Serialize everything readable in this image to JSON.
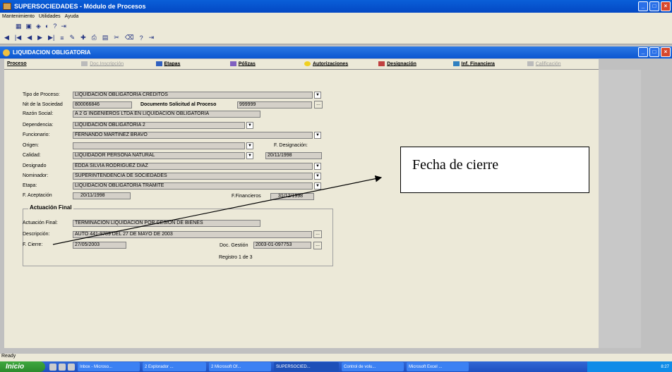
{
  "app": {
    "title": "SUPERSOCIEDADES - Módulo de Procesos",
    "menu": [
      "Mantenimiento",
      "Utilidades",
      "Ayuda"
    ]
  },
  "child": {
    "title": "LIQUIDACION OBLIGATORIA"
  },
  "tabs": [
    {
      "label": "Proceso",
      "enabled": true
    },
    {
      "label": "Doc.Inscripción",
      "enabled": false
    },
    {
      "label": "Etapas",
      "enabled": true
    },
    {
      "label": "Pólizas",
      "enabled": true
    },
    {
      "label": "Autorizaciones",
      "enabled": true
    },
    {
      "label": "Designación",
      "enabled": true
    },
    {
      "label": "Inf. Financiera",
      "enabled": true
    },
    {
      "label": "Calificación",
      "enabled": false
    }
  ],
  "form": {
    "tipo_proceso_label": "Tipo de Proceso:",
    "tipo_proceso_value": "LIQUIDACIÓN OBLIGATORIA CREDITOS",
    "nit_label": "Nit de la Sociedad",
    "nit_value": "800066846",
    "doc_solicitud_label": "Documento Solicitud al Proceso",
    "doc_solicitud_value": "999999",
    "razon_label": "Razón Social:",
    "razon_value": "A 2 G INGENIEROS LTDA EN LIQUIDACION OBLIGATORIA",
    "dependencia_label": "Dependencia:",
    "dependencia_value": "LIQUIDACION OBLIGATORIA 2",
    "funcionario_label": "Funcionario:",
    "funcionario_value": "FERNANDO MARTINEZ BRAVO",
    "origen_label": "Origen:",
    "origen_value": "",
    "f_designacion_label": "F. Designación:",
    "calidad_label": "Calidad:",
    "calidad_value": "LIQUIDADOR PERSONA NATURAL",
    "f_designacion_value": "20/11/1998",
    "designado_label": "Designado",
    "designado_value": "EDDA SILVIA RODRIGUEZ DIAZ",
    "nominador_label": "Nominador:",
    "nominador_value": "SUPERINTENDENCIA DE SOCIEDADES",
    "etapa_label": "Etapa:",
    "etapa_value": "LIQUIDACION OBLIGATORIA TRAMITE",
    "f_aceptacion_label": "F. Aceptación",
    "f_aceptacion_value": "20/11/1998",
    "f_financieros_label": "F.Financieros",
    "f_financieros_value": "31/12/1998",
    "actuacion_group_label": "Actuación Final",
    "actuacion_label": "Actuación Final:",
    "actuacion_value": "TERMINACION LIQUIDACION POR CESION DE BIENES",
    "descripcion_label": "Descripción:",
    "descripcion_value": "AUTO 441-9789 DEL 27 DE MAYO DE 2003",
    "f_cierre_label": "F. Cierre:",
    "f_cierre_value": "27/05/2003",
    "doc_gestion_label": "Doc. Gestión",
    "doc_gestion_value": "2003-01-097753",
    "registro": "Registro 1 de  3"
  },
  "callout": "Fecha de cierre",
  "status": "Ready",
  "taskbar": {
    "start": "Inicio",
    "items": [
      "Inbox - Microso...",
      "2 Explorador ...",
      "2 Microsoft Of...",
      "SUPERSOCIED...",
      "Control de volu...",
      "Microsoft Excel ..."
    ],
    "clock": "8:27"
  }
}
